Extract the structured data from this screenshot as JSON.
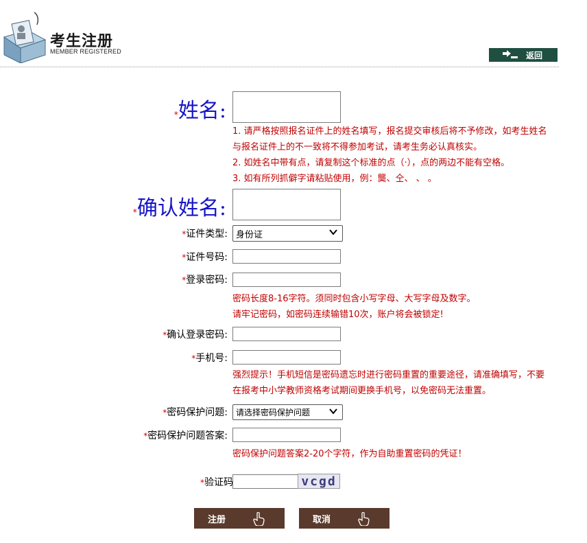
{
  "header": {
    "title_cn": "考生注册",
    "title_en": "MEMBER REGISTERED",
    "back_label": "返回"
  },
  "form": {
    "required_mark": "*",
    "name_label": "姓名:",
    "name_notes": [
      "1. 请严格按照报名证件上的姓名填写，报名提交审核后将不予修改，如考生姓名",
      "与报名证件上的不一致将不得参加考试，请考生务必认真核实。",
      "2. 如姓名中带有点，请复制这个标准的点（·），点的两边不能有空格。",
      "3. 如有所列抓僻字请粘贴使用，例：龑、仝、   、  。"
    ],
    "confirm_name_label": "确认姓名:",
    "id_type_label": "证件类型:",
    "id_type_selected": "身份证",
    "id_number_label": "证件号码:",
    "password_label": "登录密码:",
    "password_notes": [
      "密码长度8-16字符。须同时包含小写字母、大写字母及数字。",
      "请牢记密码，如密码连续输错10次，账户将会被锁定!"
    ],
    "confirm_password_label": "确认登录密码:",
    "phone_label": "手机号:",
    "phone_notes": [
      "强烈提示！手机短信是密码遗忘时进行密码重置的重要途径，请准确填写，不要",
      "在报考中小学教师资格考试期间更换手机号，以免密码无法重置。"
    ],
    "security_question_label": "密码保护问题:",
    "security_question_selected": "请选择密码保护问题",
    "security_answer_label": "密码保护问题答案:",
    "security_answer_note": "密码保护问题答案2-20个字符，作为自助重置密码的凭证！",
    "captcha_label": "验证码",
    "captcha_text": "vcgd"
  },
  "buttons": {
    "register": "注册",
    "cancel": "取消"
  },
  "colors": {
    "accent_green": "#1f4f40",
    "button_brown": "#5a3a2c",
    "note_red": "#c00000",
    "name_blue": "#1515c8"
  }
}
